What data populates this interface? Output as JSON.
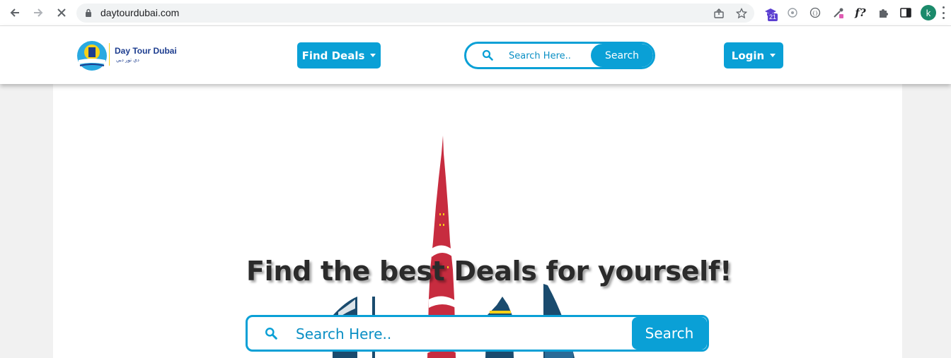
{
  "browser": {
    "url": "daytourdubai.com",
    "profile_initial": "k",
    "extension_badge": "21",
    "ext_f_label": "f?"
  },
  "header": {
    "logo_title": "Day Tour Dubai",
    "logo_subtitle": "ﺩﻱ ﺗﻮﺭ ﺩﺑﻲ",
    "find_deals_label": "Find Deals",
    "search_placeholder": "Search Here..",
    "search_button": "Search",
    "login_label": "Login"
  },
  "hero": {
    "title": "Find the best Deals for yourself!",
    "search_placeholder": "Search Here..",
    "search_button": "Search"
  },
  "colors": {
    "accent": "#0aa0d6",
    "brand_dark": "#1d3d8f",
    "tower_red": "#c72c3f"
  }
}
